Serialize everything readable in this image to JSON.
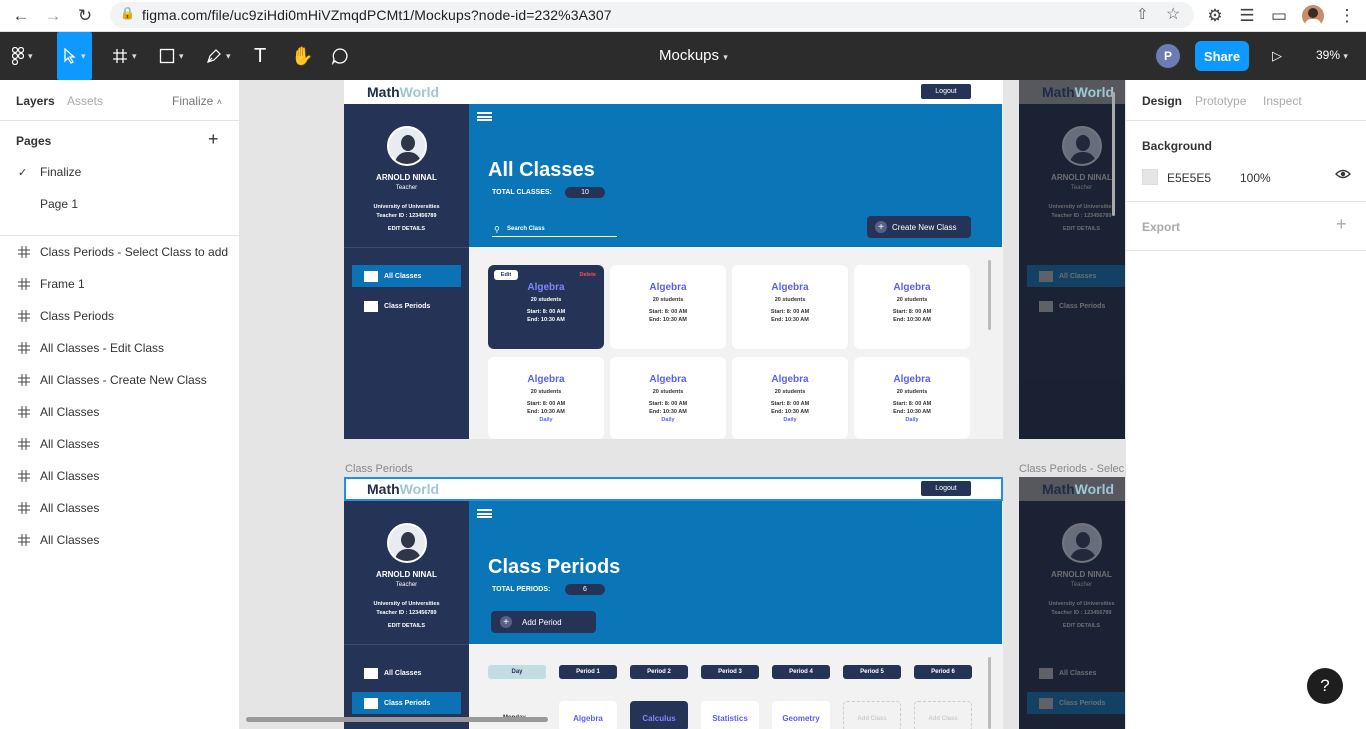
{
  "browser": {
    "url": "figma.com/file/uc9ziHdi0mHiVZmqdPCMt1/Mockups?node-id=232%3A307"
  },
  "toolbar": {
    "doc_title": "Mockups",
    "avatar_initial": "P",
    "share_label": "Share",
    "zoom": "39%"
  },
  "left_panel": {
    "tabs": [
      "Layers",
      "Assets"
    ],
    "page_selector": "Finalize",
    "pages_heading": "Pages",
    "pages": [
      {
        "label": "Finalize",
        "selected": true
      },
      {
        "label": "Page 1",
        "selected": false
      }
    ],
    "layers": [
      "Class Periods - Select Class to add",
      "Frame 1",
      "Class Periods",
      "All Classes - Edit Class",
      "All Classes - Create New Class",
      "All Classes",
      "All Classes",
      "All Classes",
      "All Classes",
      "All Classes"
    ]
  },
  "right_panel": {
    "tabs": [
      "Design",
      "Prototype",
      "Inspect"
    ],
    "background_heading": "Background",
    "bg_hex": "E5E5E5",
    "bg_opacity": "100%",
    "export_heading": "Export"
  },
  "canvas": {
    "frame2_label": "Class Periods",
    "frame3_label": "Class Periods - Selec",
    "brand_a": "Math",
    "brand_b": "World",
    "logout": "Logout",
    "profile": {
      "name": "ARNOLD NINAL",
      "role": "Teacher",
      "uni": "University of Universities",
      "teacher_id": "Teacher ID : 123456789",
      "edit": "EDIT DETAILS"
    },
    "nav": [
      "All Classes",
      "Class Periods"
    ],
    "all_classes": {
      "title": "All Classes",
      "total_label": "TOTAL CLASSES:",
      "total": "10",
      "search_placeholder": "Search Class",
      "create_label": "Create New Class",
      "edit_label": "Edit",
      "delete_label": "Delete",
      "cards_row1": [
        {
          "title": "Algebra",
          "students": "20 students",
          "start": "Start: 8: 00 AM",
          "end": "End: 10:30 AM",
          "freq": ""
        },
        {
          "title": "Algebra",
          "students": "20 students",
          "start": "Start: 8: 00 AM",
          "end": "End: 10:30 AM",
          "freq": ""
        },
        {
          "title": "Algebra",
          "students": "20 students",
          "start": "Start: 8: 00 AM",
          "end": "End: 10:30 AM",
          "freq": ""
        },
        {
          "title": "Algebra",
          "students": "20 students",
          "start": "Start: 8: 00 AM",
          "end": "End: 10:30 AM",
          "freq": ""
        }
      ],
      "cards_row2": [
        {
          "title": "Algebra",
          "students": "20 students",
          "start": "Start: 8: 00 AM",
          "end": "End: 10:30 AM",
          "freq": "Daily"
        },
        {
          "title": "Algebra",
          "students": "20 students",
          "start": "Start: 8: 00 AM",
          "end": "End: 10:30 AM",
          "freq": "Daily"
        },
        {
          "title": "Algebra",
          "students": "20 students",
          "start": "Start: 8: 00 AM",
          "end": "End: 10:30 AM",
          "freq": "Daily"
        },
        {
          "title": "Algebra",
          "students": "20 students",
          "start": "Start: 8: 00 AM",
          "end": "End: 10:30 AM",
          "freq": "Daily"
        }
      ]
    },
    "class_periods": {
      "title": "Class Periods",
      "total_label": "TOTAL PERIODS:",
      "total": "6",
      "add_label": "Add Period",
      "day_label": "Day",
      "periods": [
        "Period 1",
        "Period 2",
        "Period 3",
        "Period  4",
        "Period 5",
        "Period 6"
      ],
      "row_day": "Monday",
      "subjects": [
        "Algebra",
        "Calculus",
        "Statistics",
        "Geometry",
        "Add Class",
        "Add Class"
      ]
    }
  }
}
